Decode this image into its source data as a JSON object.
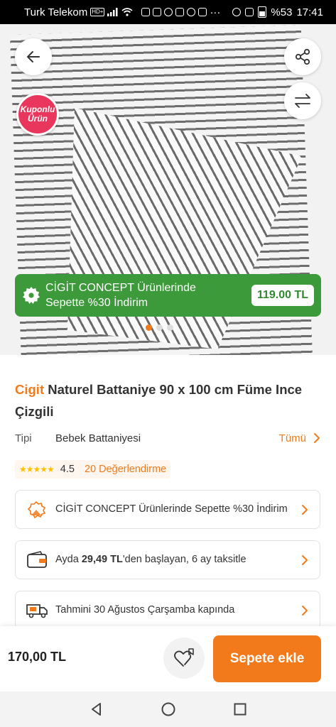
{
  "status_bar": {
    "carrier": "Turk Telekom",
    "network_badge": "HD+",
    "battery": "%53",
    "time": "17:41"
  },
  "hero": {
    "coupon_badge_line1": "Kuponlu",
    "coupon_badge_line2": "Ürün",
    "promo_line1": "CİGİT CONCEPT Ürünlerinde",
    "promo_line2": "Sepette %30 İndirim",
    "promo_price": "119.00 TL",
    "image_dot_count": 3,
    "image_dot_active": 0
  },
  "product": {
    "brand": "Cigit",
    "name": "Naturel Battaniye 90 x 100 cm Füme Ince Çizgili",
    "type_label": "Tipi",
    "type_value": "Bebek Battaniyesi",
    "type_all": "Tümü",
    "rating": "4.5",
    "rating_stars": 4.5,
    "review_count": "20 Değerlendirme"
  },
  "cards": {
    "campaign": "CİGİT CONCEPT Ürünlerinde Sepette %30 İndirim",
    "installment_prefix": "Ayda ",
    "installment_amount": "29,49 TL",
    "installment_suffix": "'den başlayan, 6 ay taksitle",
    "delivery": "Tahmini 30 Ağustos Çarşamba kapında"
  },
  "bottom_bar": {
    "price": "170,00 TL",
    "add_to_cart": "Sepete ekle"
  },
  "colors": {
    "accent": "#f27a1a",
    "promo_green": "#3c9a3b",
    "coupon_pink": "#e8365d",
    "star": "#ffc000"
  }
}
